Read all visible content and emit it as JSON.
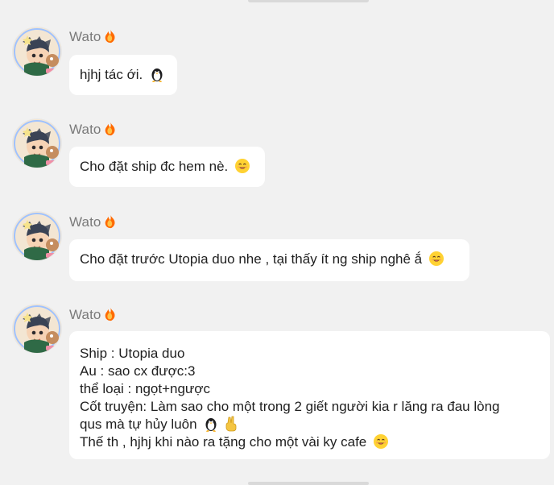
{
  "conversation": {
    "messages": [
      {
        "sender": "Wato",
        "text": "hjhj tác ới.",
        "trailing_icons": [
          "penguin-icon"
        ]
      },
      {
        "sender": "Wato",
        "text": "Cho đặt ship đc hem nè.",
        "trailing_icons": [
          "smiling-face-icon"
        ]
      },
      {
        "sender": "Wato",
        "text": "Cho đặt trước Utopia duo nhe , tại thấy ít ng ship nghê ắ",
        "trailing_icons": [
          "smiling-face-icon"
        ]
      },
      {
        "sender": "Wato",
        "lines": [
          "Ship : Utopia duo",
          "Au : sao cx được:3",
          "thể loại : ngọt+ngược",
          "Cốt truyện: Làm sao cho một trong 2 giết người kia r lăng ra đau lòng",
          "qus mà tự hủy luôn",
          "Thế th , hjhj khi nào ra tặng cho một vài ky cafe"
        ],
        "line_icons": {
          "4": [
            "penguin-icon",
            "victory-hand-icon"
          ],
          "5": [
            "smiling-face-icon"
          ]
        }
      }
    ]
  }
}
